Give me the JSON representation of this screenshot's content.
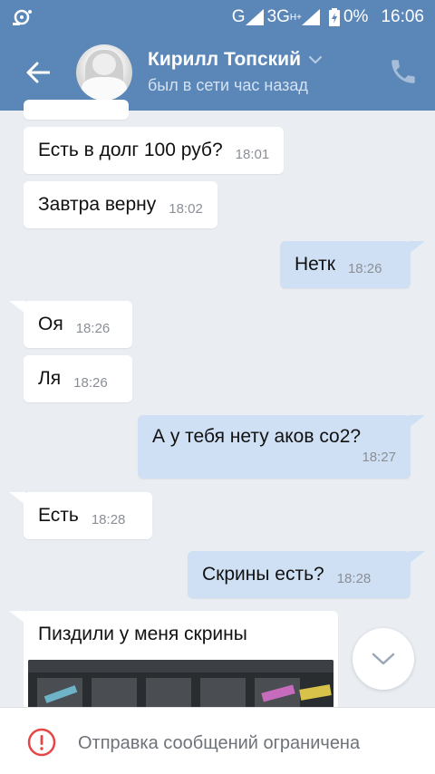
{
  "status_bar": {
    "network": "G",
    "network2": "3G",
    "network2_sup": "H+",
    "battery": "0%",
    "time": "16:06"
  },
  "header": {
    "name": "Кирилл Топский",
    "status": "был в сети час назад"
  },
  "messages": [
    {
      "dir": "in",
      "text": "Есть в долг 100 руб?",
      "time": "18:01"
    },
    {
      "dir": "in",
      "text": "Завтра верну",
      "time": "18:02"
    },
    {
      "dir": "out",
      "text": "Нетк",
      "time": "18:26"
    },
    {
      "dir": "in",
      "text": "Оя",
      "time": "18:26"
    },
    {
      "dir": "in",
      "text": "Ля",
      "time": "18:26"
    },
    {
      "dir": "out",
      "text": "А у тебя нету аков  со2?",
      "time": "18:27"
    },
    {
      "dir": "in",
      "text": "Есть",
      "time": "18:28"
    },
    {
      "dir": "out",
      "text": "Скрины есть?",
      "time": "18:28"
    },
    {
      "dir": "in",
      "text": "Пиздили у меня скрины",
      "time": ""
    }
  ],
  "bottom": {
    "text": "Отправка сообщений ограничена"
  },
  "colors": {
    "header_bg": "#5b87b8",
    "chat_bg": "#eaeef3",
    "outgoing_bubble": "#cfe0f4",
    "incoming_bubble": "#ffffff",
    "warning_red": "#e64646"
  }
}
